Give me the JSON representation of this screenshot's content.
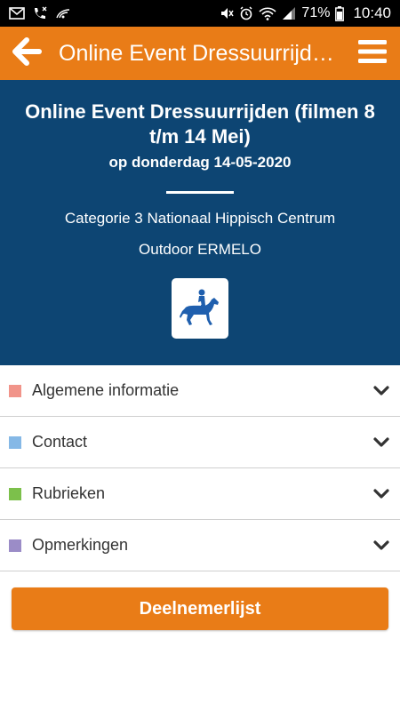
{
  "status_bar": {
    "battery_percent": "71%",
    "time": "10:40"
  },
  "toolbar": {
    "title": "Online Event Dressuurrijden …",
    "back_icon": "arrow-left-icon",
    "menu_icon": "hamburger-menu-icon"
  },
  "event": {
    "title": "Online Event Dressuurrijden (filmen 8 t/m 14 Mei)",
    "date": "op donderdag 14-05-2020",
    "category": "Categorie 3 Nationaal Hippisch Centrum",
    "location": "Outdoor ERMELO",
    "discipline_icon": "dressage-horse-rider-icon"
  },
  "sections": [
    {
      "label": "Algemene informatie",
      "color": "#f1948a"
    },
    {
      "label": "Contact",
      "color": "#85b8e6"
    },
    {
      "label": "Rubrieken",
      "color": "#7cc04b"
    },
    {
      "label": "Opmerkingen",
      "color": "#9b8cc7"
    }
  ],
  "participants_button": {
    "label": "Deelnemerlijst"
  },
  "colors": {
    "accent": "#e97c17",
    "header_bg": "#0d4573",
    "icon_blue": "#1f5fae"
  }
}
